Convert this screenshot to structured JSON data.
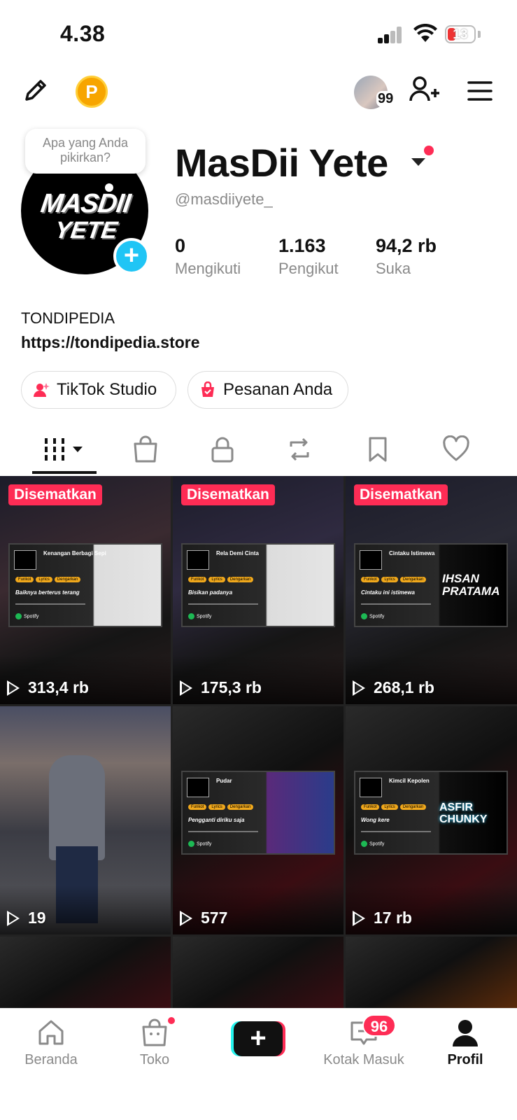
{
  "status_bar": {
    "time": "4.38",
    "battery": "13"
  },
  "top_bar": {
    "coin_label": "P",
    "recent_viewers_count": "99"
  },
  "profile": {
    "bubble_text": "Apa yang Anda pikirkan?",
    "name": "MasDii Yete",
    "handle": "@masdiiyete_",
    "logo_line1": "MASDII",
    "logo_line2": "YETE",
    "stats": [
      {
        "value": "0",
        "label": "Mengikuti"
      },
      {
        "value": "1.163",
        "label": "Pengikut"
      },
      {
        "value": "94,2 rb",
        "label": "Suka"
      }
    ],
    "bio": "TONDIPEDIA",
    "link": "https://tondipedia.store",
    "buttons": {
      "studio": "TikTok Studio",
      "orders": "Pesanan Anda"
    }
  },
  "videos": [
    {
      "pinned": "Disematkan",
      "views": "313,4 rb",
      "card_title": "Kenangan Berbagi Sepi",
      "card_lyric": "Baiknya berterus terang",
      "style": "card"
    },
    {
      "pinned": "Disematkan",
      "views": "175,3 rb",
      "card_title": "Rela Demi Cinta",
      "card_lyric": "Bisikan padanya",
      "style": "card"
    },
    {
      "pinned": "Disematkan",
      "views": "268,1 rb",
      "card_title": "Cintaku Istimewa",
      "card_lyric": "Cintaku ini istimewa",
      "overlay_text": "IHSAN PRATAMA",
      "style": "card"
    },
    {
      "pinned": "",
      "views": "19",
      "style": "street"
    },
    {
      "pinned": "",
      "views": "577",
      "card_title": "Pudar",
      "card_lyric": "Pengganti diriku saja",
      "style": "card2"
    },
    {
      "pinned": "",
      "views": "17 rb",
      "card_title": "Kimcil Kepolen",
      "card_lyric": "Wong kere",
      "overlay_text": "ASFIR CHUNKY",
      "style": "card2"
    }
  ],
  "card_tags": [
    "Funkot",
    "Lyrics",
    "Dengarkan"
  ],
  "card_spotify": "Spotify",
  "nav": {
    "home": "Beranda",
    "shop": "Toko",
    "inbox": "Kotak Masuk",
    "inbox_badge": "96",
    "profile": "Profil"
  },
  "colors": {
    "accent": "#fe2c55",
    "cyan": "#25f4ee",
    "add_blue": "#20c5f5",
    "coin": "#f7a500"
  }
}
